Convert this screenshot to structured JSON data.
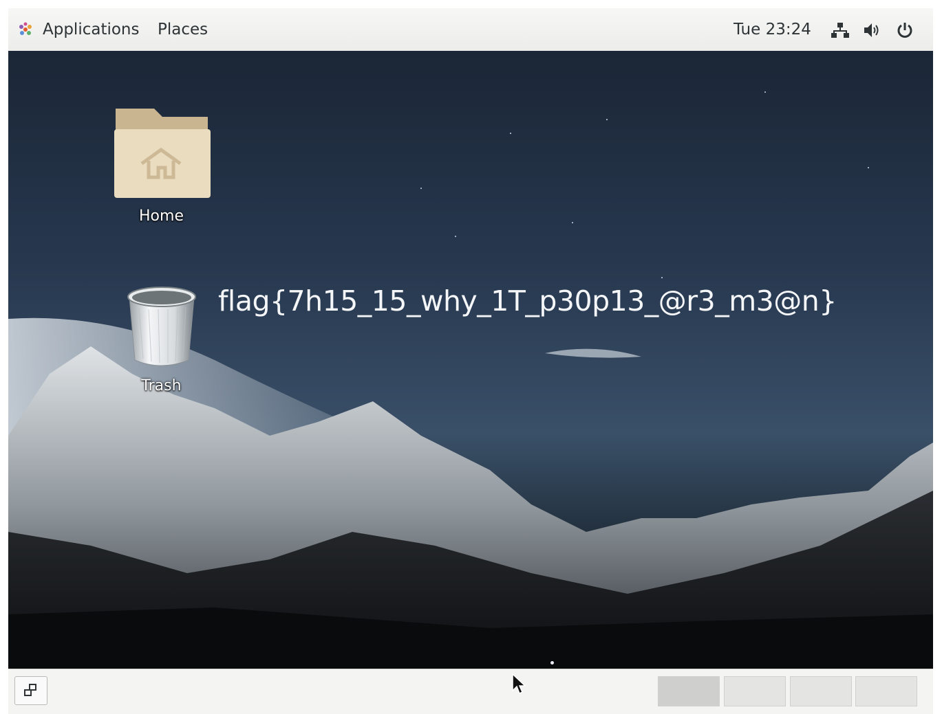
{
  "top_panel": {
    "applications_label": "Applications",
    "places_label": "Places",
    "clock": "Tue 23:24",
    "icons": [
      "gnome-foot-icon",
      "network-icon",
      "volume-icon",
      "power-icon"
    ]
  },
  "desktop": {
    "icons": [
      {
        "label": "Home",
        "icon": "home-folder-icon"
      },
      {
        "label": "Trash",
        "icon": "trash-icon"
      }
    ],
    "overlay_text": "flag{7h15_15_why_1T_p30p13_@r3_m3@n}"
  },
  "bottom_panel": {
    "workspaces": 4,
    "active_workspace": 1,
    "icons": [
      "show-desktop-icon"
    ]
  },
  "colors": {
    "panel_bg": "#efefee",
    "panel_text": "#2e3436",
    "folder": "#e7d9bd",
    "sky_top": "#1b2636"
  }
}
